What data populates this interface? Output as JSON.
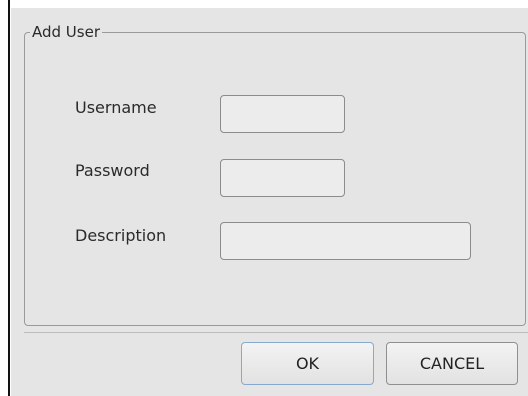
{
  "dialog": {
    "group_title": "Add User",
    "fields": [
      {
        "label": "Username",
        "value": "",
        "placeholder": ""
      },
      {
        "label": "Password",
        "value": "",
        "placeholder": ""
      },
      {
        "label": "Description",
        "value": "",
        "placeholder": ""
      }
    ],
    "buttons": {
      "ok_label": "OK",
      "cancel_label": "CANCEL"
    }
  },
  "colors": {
    "dialog_background": "#e5e5e5",
    "input_background": "#ececec",
    "ok_border_accent": "#86a9cf"
  }
}
